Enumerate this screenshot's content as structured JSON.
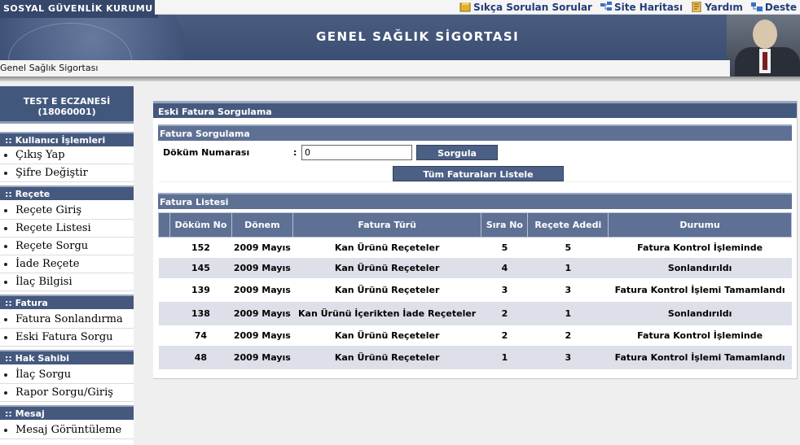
{
  "header": {
    "org_name": "SOSYAL GÜVENLİK KURUMU",
    "banner_title": "GENEL SAĞLIK SİGORTASI",
    "breadcrumb": "Genel Sağlık Sigortası",
    "top_links": [
      {
        "label": "Sıkça Sorulan Sorular",
        "icon": "book-icon"
      },
      {
        "label": "Site Haritası",
        "icon": "sitemap-icon"
      },
      {
        "label": "Yardım",
        "icon": "help-icon"
      },
      {
        "label": "Deste",
        "icon": "support-icon"
      }
    ]
  },
  "sidebar": {
    "user_name": "TEST E ECZANESİ",
    "user_code": "(18060001)",
    "sections": [
      {
        "title": ":: Kullanıcı İşlemleri",
        "items": [
          "Çıkış Yap",
          "Şifre Değiştir"
        ]
      },
      {
        "title": ":: Reçete",
        "items": [
          "Reçete Giriş",
          "Reçete Listesi",
          "Reçete Sorgu",
          "İade Reçete",
          "İlaç Bilgisi"
        ]
      },
      {
        "title": ":: Fatura",
        "items": [
          "Fatura Sonlandırma",
          "Eski Fatura Sorgu"
        ]
      },
      {
        "title": ":: Hak Sahibi",
        "items": [
          "İlaç Sorgu",
          "Rapor Sorgu/Giriş"
        ]
      },
      {
        "title": ":: Mesaj",
        "items": [
          "Mesaj Görüntüleme"
        ]
      }
    ]
  },
  "main": {
    "title": "Eski Fatura Sorgulama",
    "query_section": "Fatura Sorgulama",
    "doc_label": "Döküm Numarası",
    "doc_colon": ":",
    "doc_value": "0",
    "query_button": "Sorgula",
    "list_all_button": "Tüm Faturaları Listele",
    "list_section": "Fatura Listesi",
    "columns": [
      "Döküm No",
      "Dönem",
      "Fatura Türü",
      "Sıra No",
      "Reçete Adedi",
      "Durumu"
    ],
    "rows": [
      {
        "no": "152",
        "period": "2009 Mayıs",
        "type": "Kan Ürünü Reçeteler",
        "seq": "5",
        "count": "5",
        "status": "Fatura Kontrol İşleminde"
      },
      {
        "no": "145",
        "period": "2009 Mayıs",
        "type": "Kan Ürünü Reçeteler",
        "seq": "4",
        "count": "1",
        "status": "Sonlandırıldı"
      },
      {
        "no": "139",
        "period": "2009 Mayıs",
        "type": "Kan Ürünü Reçeteler",
        "seq": "3",
        "count": "3",
        "status": "Fatura Kontrol İşlemi Tamamlandı"
      },
      {
        "no": "138",
        "period": "2009 Mayıs",
        "type": "Kan Ürünü İçerikten İade Reçeteler",
        "seq": "2",
        "count": "1",
        "status": "Sonlandırıldı"
      },
      {
        "no": "74",
        "period": "2009 Mayıs",
        "type": "Kan Ürünü Reçeteler",
        "seq": "2",
        "count": "2",
        "status": "Fatura Kontrol İşleminde"
      },
      {
        "no": "48",
        "period": "2009 Mayıs",
        "type": "Kan Ürünü Reçeteler",
        "seq": "1",
        "count": "3",
        "status": "Fatura Kontrol İşlemi Tamamlandı"
      }
    ]
  }
}
